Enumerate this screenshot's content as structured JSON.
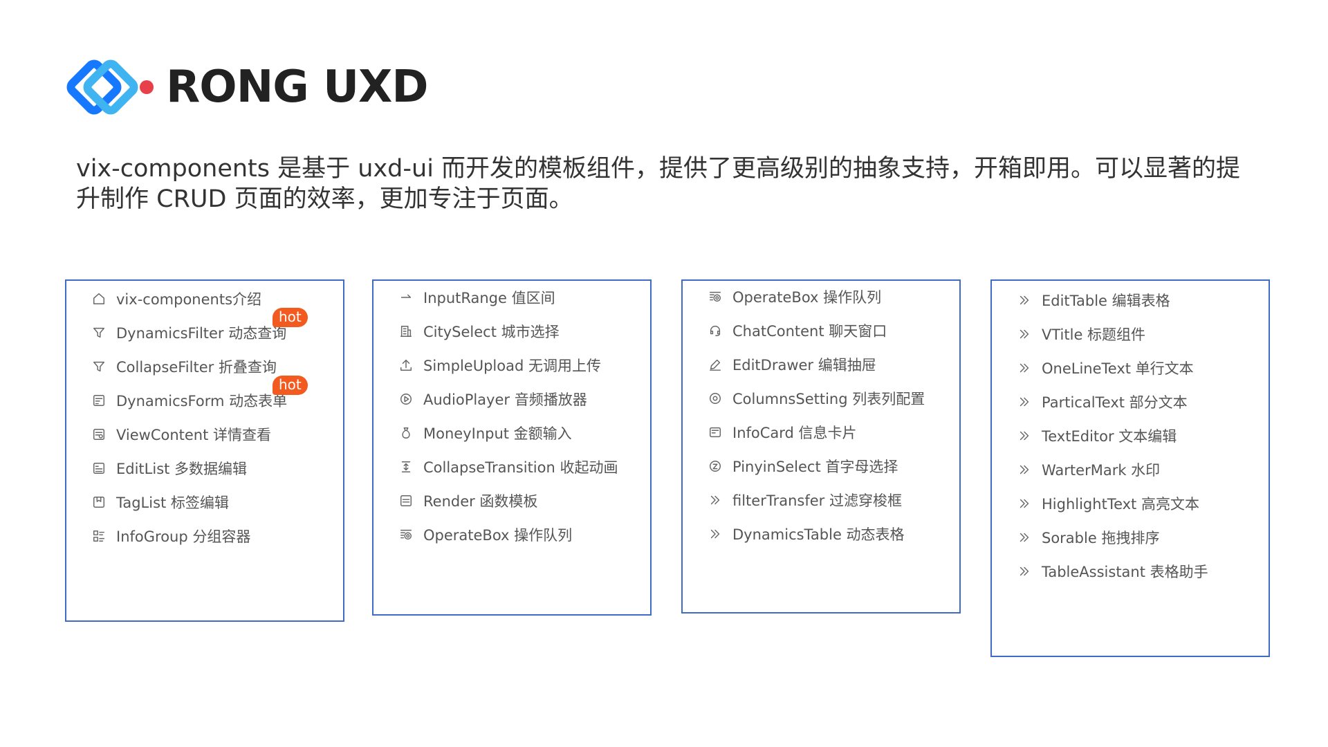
{
  "brand": {
    "name": "RONG UXD",
    "colors": {
      "blue_dark": "#1677ff",
      "blue_light": "#3fb4f0",
      "red_dot": "#e8404b"
    }
  },
  "intro": {
    "text": "vix-components 是基于 uxd-ui 而开发的模板组件，提供了更高级别的抽象支持，开箱即用。可以显著的提升制作 CRUD 页面的效率，更加专注于页面。"
  },
  "colors": {
    "card_border": "#3f6bc7",
    "hot_badge": "#f25a1f"
  },
  "columns": [
    {
      "items": [
        {
          "icon": "home-icon",
          "label": "vix-components介绍"
        },
        {
          "icon": "filter-icon",
          "label": "DynamicsFilter 动态查询",
          "badge": "hot"
        },
        {
          "icon": "filter-icon",
          "label": "CollapseFilter 折叠查询"
        },
        {
          "icon": "form-icon",
          "label": "DynamicsForm 动态表单",
          "badge": "hot"
        },
        {
          "icon": "view-content-icon",
          "label": "ViewContent 详情查看"
        },
        {
          "icon": "edit-list-icon",
          "label": "EditList 多数据编辑"
        },
        {
          "icon": "tag-list-icon",
          "label": "TagList 标签编辑"
        },
        {
          "icon": "group-icon",
          "label": "InfoGroup 分组容器"
        }
      ]
    },
    {
      "items": [
        {
          "icon": "range-arrow-icon",
          "label": "InputRange 值区间"
        },
        {
          "icon": "building-icon",
          "label": "CitySelect 城市选择"
        },
        {
          "icon": "upload-icon",
          "label": "SimpleUpload 无调用上传"
        },
        {
          "icon": "play-circle-icon",
          "label": "AudioPlayer 音频播放器"
        },
        {
          "icon": "money-bag-icon",
          "label": "MoneyInput 金额输入"
        },
        {
          "icon": "collapse-vertical-icon",
          "label": "CollapseTransition 收起动画"
        },
        {
          "icon": "template-icon",
          "label": "Render 函数模板"
        },
        {
          "icon": "operate-queue-icon",
          "label": "OperateBox 操作队列"
        }
      ]
    },
    {
      "items": [
        {
          "icon": "operate-queue-icon",
          "label": "OperateBox 操作队列"
        },
        {
          "icon": "headset-icon",
          "label": "ChatContent 聊天窗口"
        },
        {
          "icon": "edit-icon",
          "label": "EditDrawer 编辑抽屉"
        },
        {
          "icon": "settings-circle-icon",
          "label": "ColumnsSetting 列表列配置"
        },
        {
          "icon": "card-icon",
          "label": "InfoCard 信息卡片"
        },
        {
          "icon": "pinyin-icon",
          "label": "PinyinSelect 首字母选择"
        },
        {
          "icon": "double-chevron-right-icon",
          "label": "filterTransfer 过滤穿梭框"
        },
        {
          "icon": "double-chevron-right-icon",
          "label": "DynamicsTable 动态表格"
        }
      ]
    },
    {
      "items": [
        {
          "icon": "double-chevron-right-icon",
          "label": "EditTable 编辑表格"
        },
        {
          "icon": "double-chevron-right-icon",
          "label": "VTitle 标题组件"
        },
        {
          "icon": "double-chevron-right-icon",
          "label": "OneLineText 单行文本"
        },
        {
          "icon": "double-chevron-right-icon",
          "label": "ParticalText 部分文本"
        },
        {
          "icon": "double-chevron-right-icon",
          "label": "TextEditor 文本编辑"
        },
        {
          "icon": "double-chevron-right-icon",
          "label": "WarterMark 水印"
        },
        {
          "icon": "double-chevron-right-icon",
          "label": "HighlightText 高亮文本"
        },
        {
          "icon": "double-chevron-right-icon",
          "label": "Sorable 拖拽排序"
        },
        {
          "icon": "double-chevron-right-icon",
          "label": "TableAssistant 表格助手"
        }
      ]
    }
  ]
}
